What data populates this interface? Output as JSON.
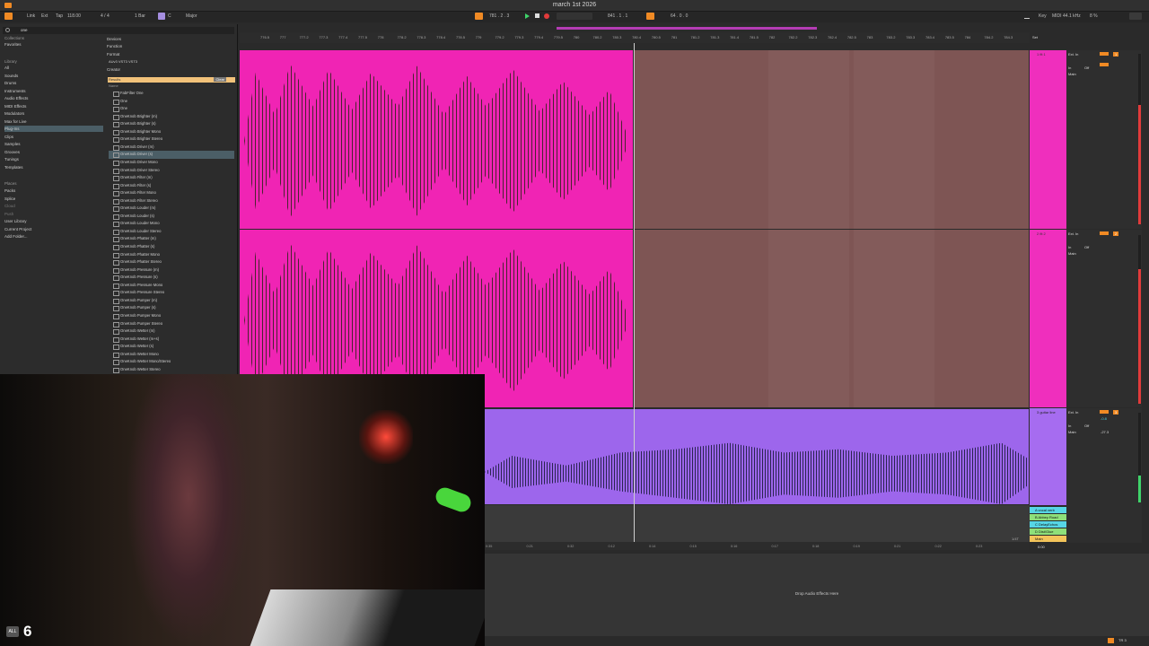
{
  "window": {
    "title": "march 1st 2026"
  },
  "toolbar": {
    "link": "Link",
    "ext": "Ext",
    "tap": "Tap",
    "tempo": "118.00",
    "signature": "4 / 4",
    "quantize": "1 Bar",
    "key": "C",
    "scale": "Major",
    "position": "781 . 2 . 3",
    "loop_start": "841 . 1 . 1",
    "loop_len": "64 . 0 . 0",
    "key_btn": "Key",
    "midi_label": "MIDI",
    "sample_rate": "44.1 kHz",
    "cpu": "8 %"
  },
  "browser": {
    "search_query": "one",
    "collections_label": "Collections",
    "collections": [
      "Favorites"
    ],
    "library_label": "Library",
    "library": [
      "All",
      "Sounds",
      "Drums",
      "Instruments",
      "Audio Effects",
      "MIDI Effects",
      "Modulators",
      "Max for Live",
      "Plug-Ins",
      "Clips",
      "Samples",
      "Grooves",
      "Tunings",
      "Templates"
    ],
    "selected_library": "Plug-Ins",
    "places_label": "Places",
    "places": [
      "Packs",
      "Splice",
      "Cloud",
      "Push",
      "User Library",
      "Current Project",
      "Add Folder..."
    ],
    "filters": [
      "Devices",
      "Function",
      "Format",
      "AUv3 VST3 VST3",
      "Creator"
    ],
    "results_label": "Results",
    "clear_label": "Clear",
    "name_label": "Name",
    "results": [
      "FabFilter One",
      "One",
      "One",
      "OneKnob Brighter (m)",
      "OneKnob Brighter (s)",
      "OneKnob Brighter Mono",
      "OneKnob Brighter Stereo",
      "OneKnob Driver (m)",
      "OneKnob Driver (s)",
      "OneKnob Driver Mono",
      "OneKnob Driver Stereo",
      "OneKnob Filter (m)",
      "OneKnob Filter (s)",
      "OneKnob Filter Mono",
      "OneKnob Filter Stereo",
      "OneKnob Louder (m)",
      "OneKnob Louder (s)",
      "OneKnob Louder Mono",
      "OneKnob Louder Stereo",
      "OneKnob Phatter (m)",
      "OneKnob Phatter (s)",
      "OneKnob Phatter Mono",
      "OneKnob Phatter Stereo",
      "OneKnob Pressure (m)",
      "OneKnob Pressure (s)",
      "OneKnob Pressure Mono",
      "OneKnob Pressure Stereo",
      "OneKnob Pumper (m)",
      "OneKnob Pumper (s)",
      "OneKnob Pumper Mono",
      "OneKnob Pumper Stereo",
      "OneKnob Wetter (m)",
      "OneKnob Wetter (m+s)",
      "OneKnob Wetter (s)",
      "OneKnob Wetter Mono",
      "OneKnob Wetter Mono/Stereo",
      "OneKnob Wetter Stereo"
    ],
    "selected_result": "OneKnob Driver (s)"
  },
  "ruler": {
    "labels": [
      "776.5",
      "777",
      "777.2",
      "777.3",
      "777.4",
      "777.5",
      "778",
      "778.2",
      "778.3",
      "778.4",
      "778.5",
      "779",
      "779.2",
      "779.3",
      "779.4",
      "779.5",
      "780",
      "780.2",
      "780.3",
      "780.4",
      "780.5",
      "781",
      "781.2",
      "781.3",
      "781.4",
      "781.5",
      "782",
      "782.2",
      "782.3",
      "782.4",
      "782.5",
      "783",
      "783.2",
      "783.3",
      "783.4",
      "783.5",
      "784",
      "784.2",
      "784.3"
    ],
    "set_label": "Set"
  },
  "tracks": [
    {
      "name": "1 fit 1",
      "input": "Ext. In",
      "monitor": "In",
      "auto": "Auto",
      "off": "Off",
      "out": "Main",
      "num": "1"
    },
    {
      "name": "2 fit 2",
      "input": "Ext. In",
      "monitor": "In",
      "auto": "Auto",
      "off": "Off",
      "out": "Main",
      "num": "2"
    },
    {
      "name": "3 guitar line",
      "input": "Ext. In",
      "monitor": "In",
      "auto": "Auto",
      "off": "Off",
      "out": "Main",
      "num": "3",
      "vol": "-0.8",
      "pan": "-27.3"
    }
  ],
  "returns": [
    {
      "name": "A vocal verb",
      "num": "A"
    },
    {
      "name": "B Abbey Road",
      "num": "B"
    },
    {
      "name": "C DelayEchos",
      "num": "C"
    },
    {
      "name": "D Dist/Glue",
      "num": "D"
    },
    {
      "name": "Main",
      "num": "1/2"
    }
  ],
  "timeline": {
    "labels": [
      "0:35",
      "0:21",
      "0:32",
      "0:12",
      "0:14",
      "0:15",
      "0:16",
      "0:17",
      "0:18",
      "0:19",
      "0:21",
      "0:22",
      "0:23"
    ],
    "zoom": "1/4T",
    "time": "0:00"
  },
  "device_panel": {
    "drop_hint": "Drop Audio Effects Here"
  },
  "status": {
    "track": "TR 3"
  },
  "overlay": {
    "badge": "ALL",
    "number": "6"
  },
  "colors": {
    "accent": "#f08a24",
    "pink_clip": "#f024b4",
    "purple_clip": "#9d66ec",
    "empty_lane": "#7e5554"
  }
}
